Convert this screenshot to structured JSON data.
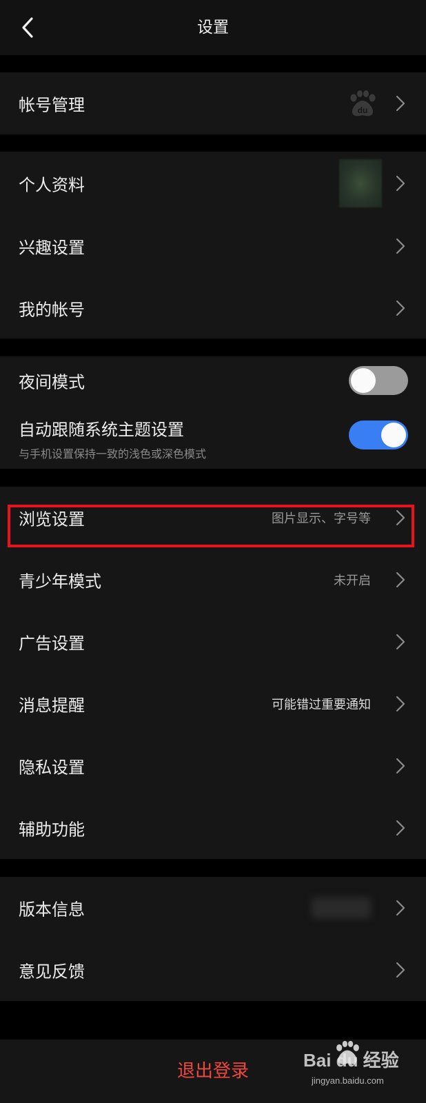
{
  "header": {
    "title": "设置",
    "back_icon": "chevron-left-icon"
  },
  "account_group": {
    "account_management": {
      "label": "帐号管理",
      "icon": "baidu-paw-logo"
    }
  },
  "profile_group": {
    "personal_info": {
      "label": "个人资料"
    },
    "interest_settings": {
      "label": "兴趣设置"
    },
    "my_account": {
      "label": "我的帐号"
    }
  },
  "display_group": {
    "night_mode": {
      "label": "夜间模式",
      "enabled": false
    },
    "follow_system_theme": {
      "label": "自动跟随系统主题设置",
      "description": "与手机设置保持一致的浅色或深色模式",
      "enabled": true
    }
  },
  "settings_group": {
    "browse_settings": {
      "label": "浏览设置",
      "value": "图片显示、字号等",
      "highlighted": true
    },
    "youth_mode": {
      "label": "青少年模式",
      "value": "未开启"
    },
    "ad_settings": {
      "label": "广告设置"
    },
    "message_reminder": {
      "label": "消息提醒",
      "value": "可能错过重要通知"
    },
    "privacy_settings": {
      "label": "隐私设置"
    },
    "accessibility": {
      "label": "辅助功能"
    }
  },
  "about_group": {
    "version_info": {
      "label": "版本信息"
    },
    "feedback": {
      "label": "意见反馈"
    }
  },
  "logout": {
    "label": "退出登录"
  },
  "watermark": {
    "text": "Bai du 经验",
    "url": "jingyan.baidu.com"
  },
  "colors": {
    "background": "#000000",
    "card": "#161616",
    "toggle_on": "#3a7ef4",
    "toggle_off": "#9b9b9b",
    "logout_text": "#f0483e",
    "highlight_border": "#e8131d"
  }
}
